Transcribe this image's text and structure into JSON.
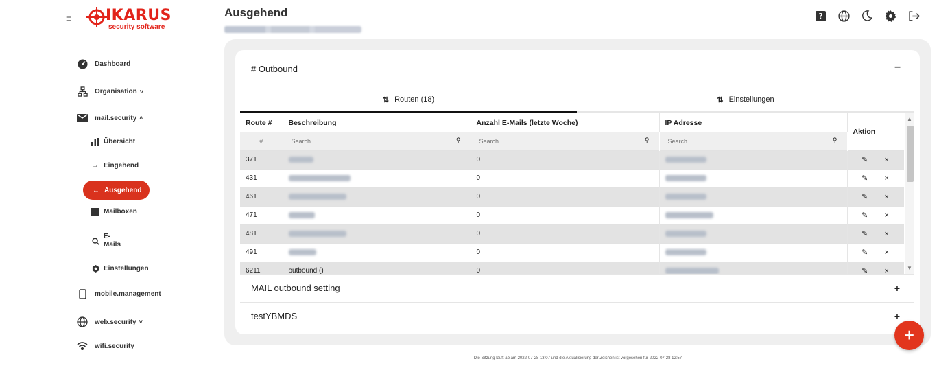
{
  "brand": {
    "name": "IKARUS",
    "tagline": "security software",
    "color": "#e2231a"
  },
  "header": {
    "title": "Ausgehend",
    "icons": [
      "help-icon",
      "globe-icon",
      "moon-icon",
      "gear-icon",
      "logout-icon"
    ]
  },
  "sidebar": {
    "items": [
      {
        "label": "Dashboard",
        "icon": "dashboard-icon"
      },
      {
        "label": "Organisation",
        "icon": "org-tree-icon"
      },
      {
        "label": "mail.security",
        "icon": "mail-icon"
      },
      {
        "label": "Übersicht",
        "icon": "bar-chart-icon"
      },
      {
        "label": "Eingehend",
        "icon": "arrow-right-icon"
      },
      {
        "label": "Ausgehend",
        "icon": "arrow-left-icon"
      },
      {
        "label": "Mailboxen",
        "icon": "mailbox-icon"
      },
      {
        "label": "E-",
        "label2": "Mails",
        "icon": "search-icon"
      },
      {
        "label": "Einstellungen",
        "icon": "gear-icon"
      },
      {
        "label": "mobile.management",
        "icon": "phone-icon"
      },
      {
        "label": "web.security",
        "icon": "globe-icon"
      },
      {
        "label": "wifi.security",
        "icon": "wifi-icon"
      }
    ]
  },
  "card": {
    "title": "# Outbound",
    "collapse_symbol": "–",
    "tabs": [
      {
        "label": "Routen (18)",
        "icon": "routes-icon"
      },
      {
        "label": "Einstellungen",
        "icon": "sliders-icon"
      }
    ],
    "table": {
      "columns": [
        "Route #",
        "Beschreibung",
        "Anzahl E-Mails (letzte Woche)",
        "IP Adresse",
        "Aktion"
      ],
      "filter_hash": "#",
      "search_placeholder": "Search...",
      "rows": [
        {
          "route": "371",
          "count": "0"
        },
        {
          "route": "431",
          "count": "0"
        },
        {
          "route": "461",
          "count": "0"
        },
        {
          "route": "471",
          "count": "0"
        },
        {
          "route": "481",
          "count": "0"
        },
        {
          "route": "491",
          "count": "0"
        },
        {
          "route": "6211",
          "description": "outbound ()",
          "count": "0"
        }
      ],
      "edit_symbol": "✎",
      "delete_symbol": "×"
    },
    "accordions": [
      {
        "label": "MAIL outbound setting",
        "symbol": "+"
      },
      {
        "label": "testYBMDS",
        "symbol": "+"
      }
    ]
  },
  "fab": {
    "symbol": "+",
    "color": "#e2351d"
  },
  "footer": {
    "text": "Die Sitzung läuft ab am 2022-07-28 13:07 und die Aktualisierung der Zeichen ist vorgesehen für 2022-07-28 12:57"
  }
}
